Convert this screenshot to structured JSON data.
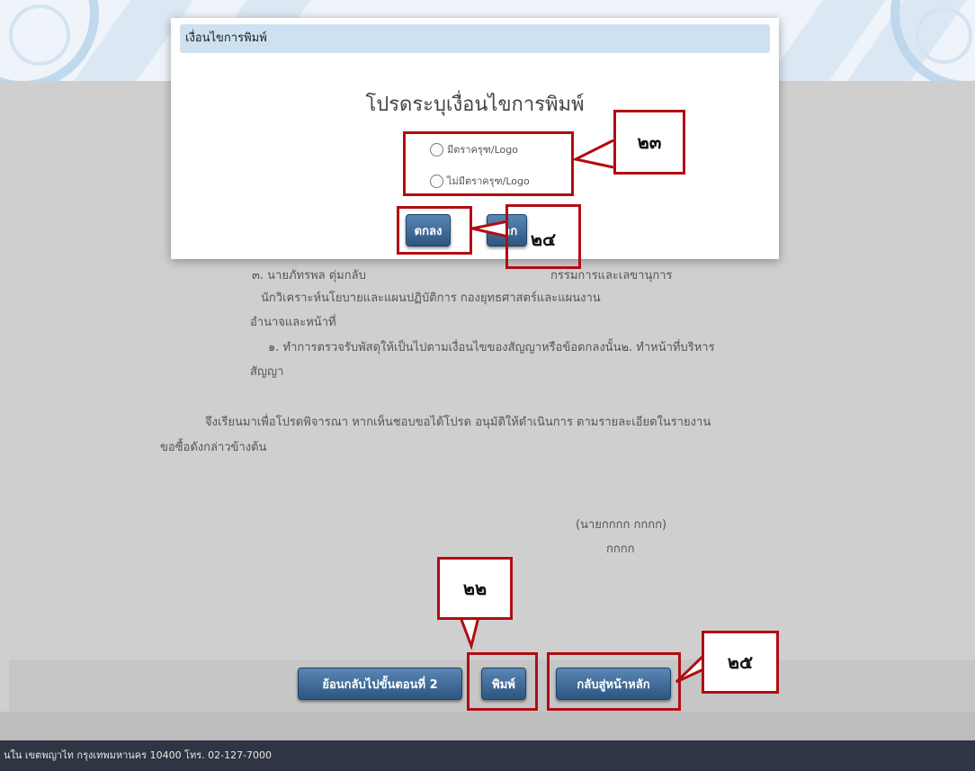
{
  "dialog": {
    "title": "เงื่อนไขการพิมพ์",
    "heading": "โปรดระบุเงื่อนไขการพิมพ์",
    "options": [
      "มีตราครุฑ/Logo",
      "ไม่มีตราครุฑ/Logo"
    ],
    "ok_label": "ตกลง",
    "cancel_label": "ออก"
  },
  "document": {
    "line1_name": "๓. นายภัทรพล ตุ่มกลับ",
    "line1_role": "กรรมการและเลขานุการ",
    "line2": "นักวิเคราะห์นโยบายและแผนปฏิบัติการ กองยุทธศาสตร์และแผนงาน",
    "line3": "อำนาจและหน้าที่",
    "line4": "๑. ทำการตรวจรับพัสดุให้เป็นไปตามเงื่อนไขของสัญญาหรือข้อตกลงนั้น๒. ทำหน้าที่บริหาร",
    "line5": "สัญญา",
    "line6": "จึงเรียนมาเพื่อโปรดพิจารณา หากเห็นชอบขอได้โปรด อนุมัติให้ดำเนินการ ตามรายละเอียดในรายงาน",
    "line7": "ขอซื้อดังกล่าวข้างต้น",
    "signature_name": "(นายกกกก กกกก)",
    "signature_title": "กกกก"
  },
  "actions": {
    "back_label": "ย้อนกลับไปขั้นตอนที่ 2",
    "print_label": "พิมพ์",
    "home_label": "กลับสู่หน้าหลัก"
  },
  "footer_text": "นใน เขตพญาไท กรุงเทพมหานคร 10400 โทร. 02-127-7000",
  "annotations": {
    "a22": "๒๒",
    "a23": "๒๓",
    "a24": "๒๔",
    "a25": "๒๕"
  },
  "colors": {
    "annotation_red": "#b10d12",
    "button_blue": "#2c5680",
    "footer_dark": "#2f3543"
  }
}
